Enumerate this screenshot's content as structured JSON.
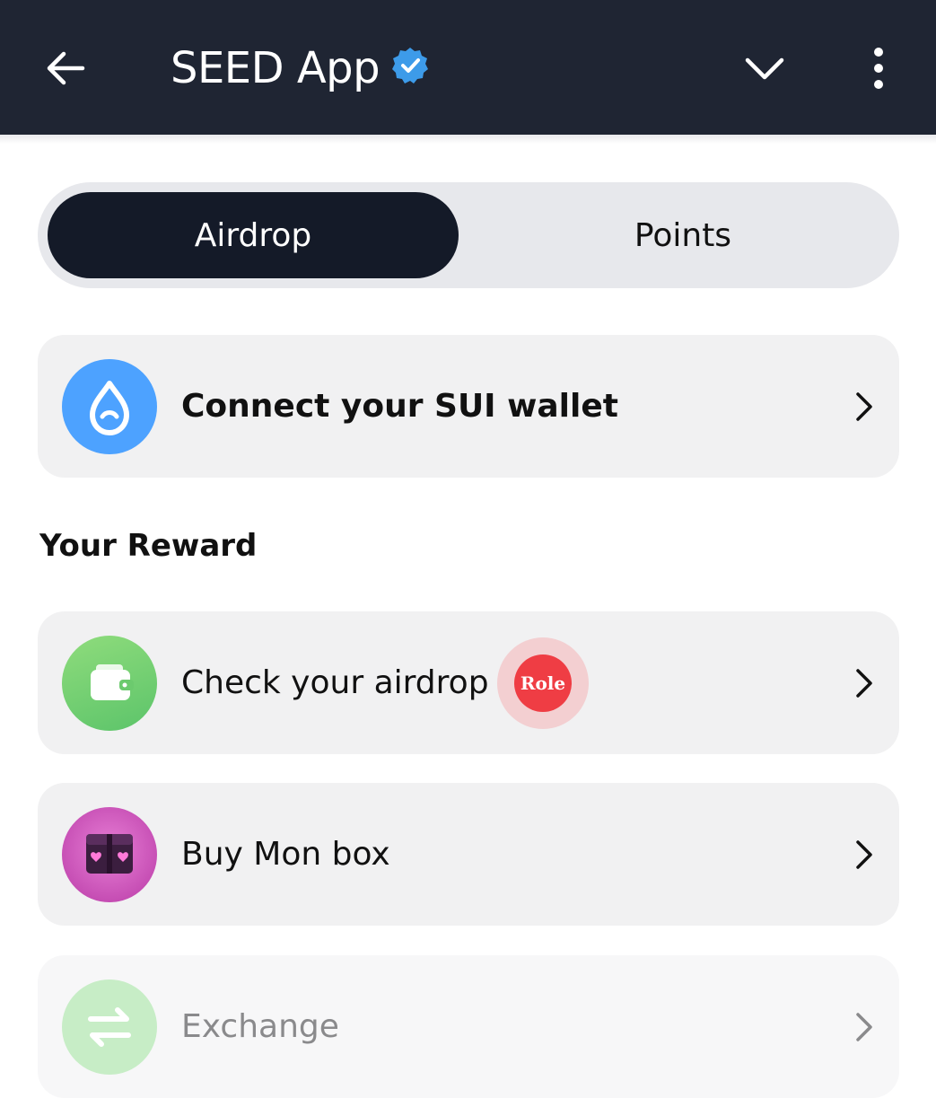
{
  "header": {
    "title": "SEED App",
    "back_icon": "arrow-left-icon",
    "verified_icon": "verified-badge-icon",
    "collapse_icon": "chevron-down-icon",
    "more_icon": "more-vertical-icon"
  },
  "tabs": [
    {
      "label": "Airdrop",
      "active": true
    },
    {
      "label": "Points",
      "active": false
    }
  ],
  "wallet": {
    "label": "Connect your SUI wallet",
    "icon": "sui-drop-icon"
  },
  "rewards": {
    "section_title": "Your Reward",
    "items": [
      {
        "label": "Check your airdrop",
        "icon": "wallet-icon",
        "badge": "Role"
      },
      {
        "label": "Buy Mon box",
        "icon": "mon-box-icon"
      },
      {
        "label": "Exchange",
        "icon": "exchange-icon",
        "disabled": true
      }
    ]
  },
  "colors": {
    "header_bg": "#1f2533",
    "active_tab_bg": "#141a28",
    "card_bg": "#f1f1f2",
    "verified_blue": "#3d9be9",
    "sui_blue": "#4da2ff",
    "green": "#6fcf73",
    "badge_red": "#ef3d44"
  }
}
